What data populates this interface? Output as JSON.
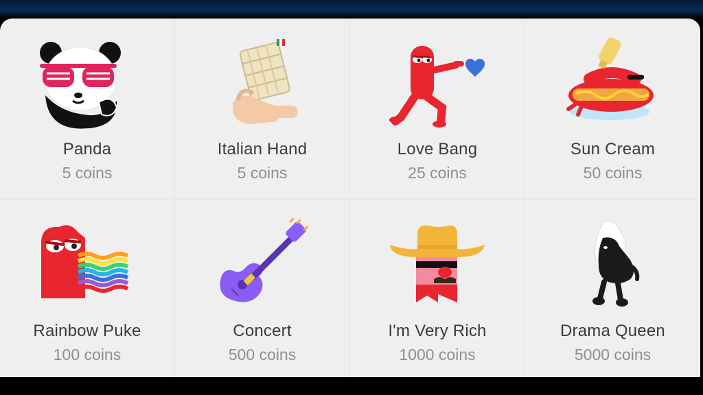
{
  "gifts": [
    {
      "name": "Panda",
      "price": "5 coins",
      "icon": "panda-icon"
    },
    {
      "name": "Italian Hand",
      "price": "5 coins",
      "icon": "italian-hand-icon"
    },
    {
      "name": "Love Bang",
      "price": "25 coins",
      "icon": "love-bang-icon"
    },
    {
      "name": "Sun Cream",
      "price": "50 coins",
      "icon": "sun-cream-icon"
    },
    {
      "name": "Rainbow Puke",
      "price": "100 coins",
      "icon": "rainbow-puke-icon"
    },
    {
      "name": "Concert",
      "price": "500 coins",
      "icon": "guitar-icon"
    },
    {
      "name": "I'm Very Rich",
      "price": "1000 coins",
      "icon": "cowboy-icon"
    },
    {
      "name": "Drama Queen",
      "price": "5000 coins",
      "icon": "drama-queen-icon"
    }
  ],
  "colors": {
    "panel_background": "#efefef",
    "name_text": "#3b3b3b",
    "price_text": "#8f8f8f"
  }
}
